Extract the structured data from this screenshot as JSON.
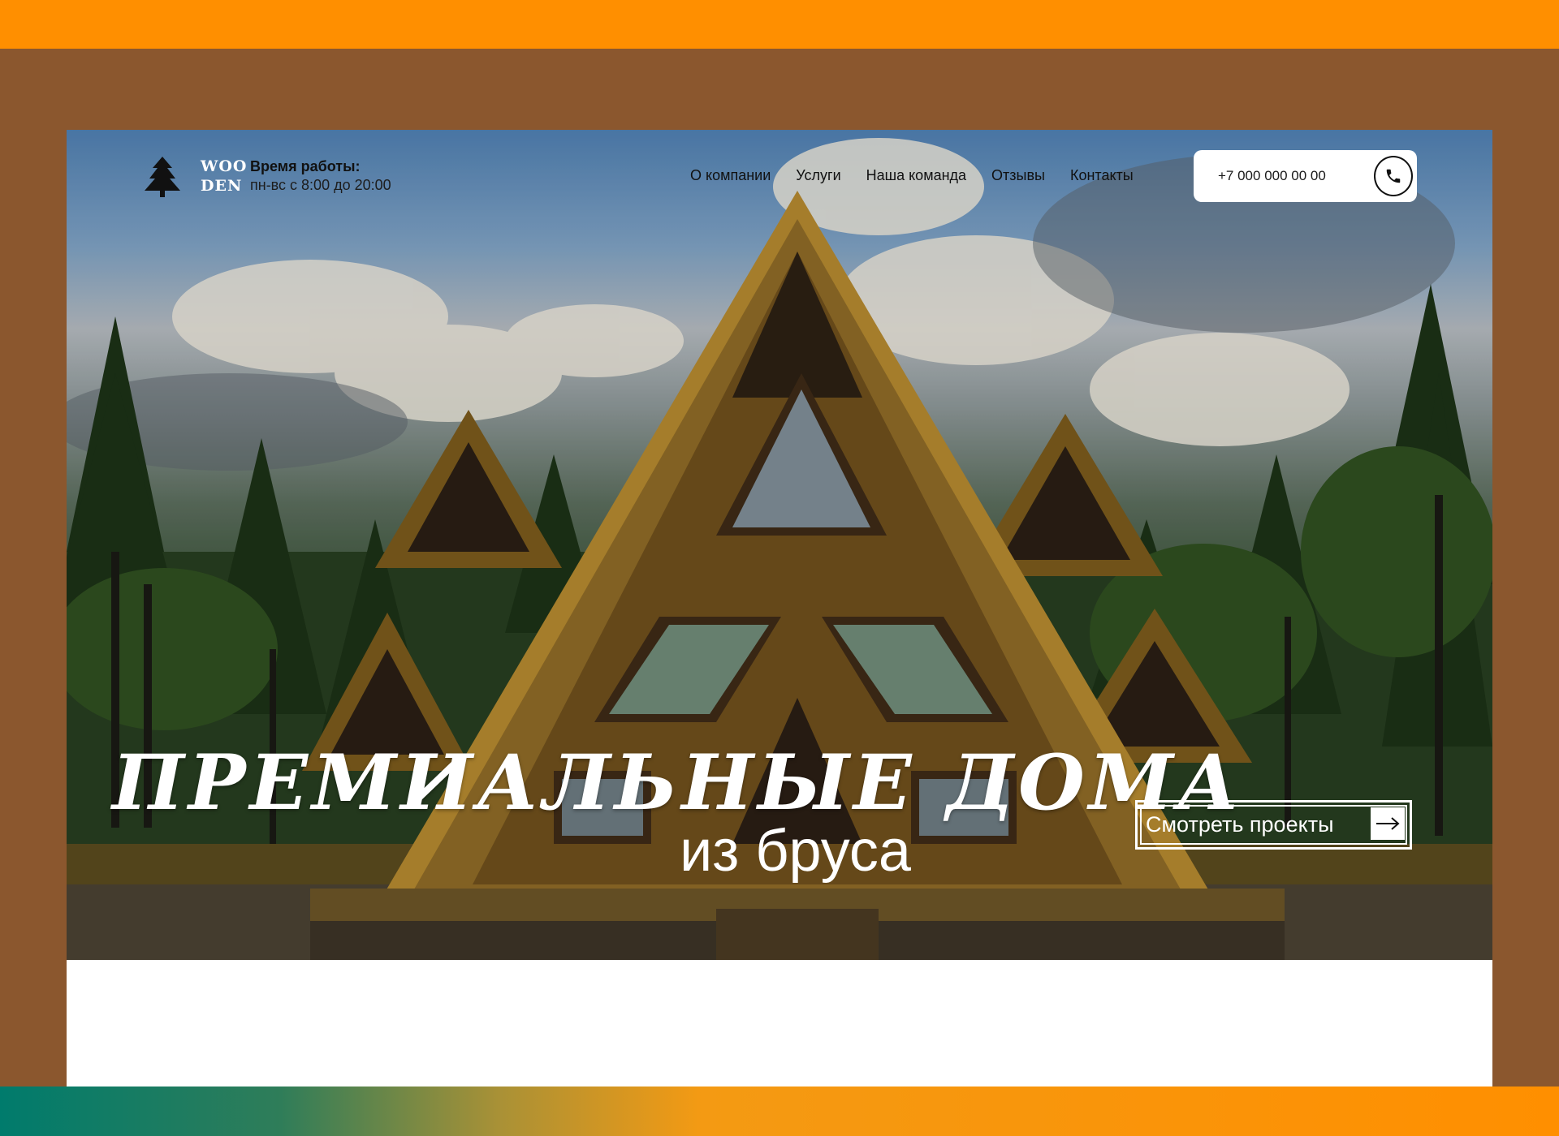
{
  "colors": {
    "accent_orange": "#ff8f00",
    "page_brown": "#8b572e",
    "gradient_teal": "#007b6c",
    "white": "#ffffff"
  },
  "logo": {
    "icon": "tree-icon",
    "line1": "WOO",
    "line2": "DEN"
  },
  "hours": {
    "title": "Время работы:",
    "value": "пн-вс с 8:00 до 20:00"
  },
  "nav": {
    "items": [
      {
        "label": "О компании"
      },
      {
        "label": "Услуги"
      },
      {
        "label": "Наша команда"
      },
      {
        "label": "Отзывы"
      },
      {
        "label": "Контакты"
      }
    ]
  },
  "phone": {
    "number": "+7 000 000 00 00",
    "icon": "phone-icon"
  },
  "hero": {
    "headline": "ПРЕМИАЛЬНЫЕ ДОМА",
    "subline": "из бруса",
    "cta_label": "Смотреть проекты",
    "cta_icon": "arrow-right-icon"
  }
}
